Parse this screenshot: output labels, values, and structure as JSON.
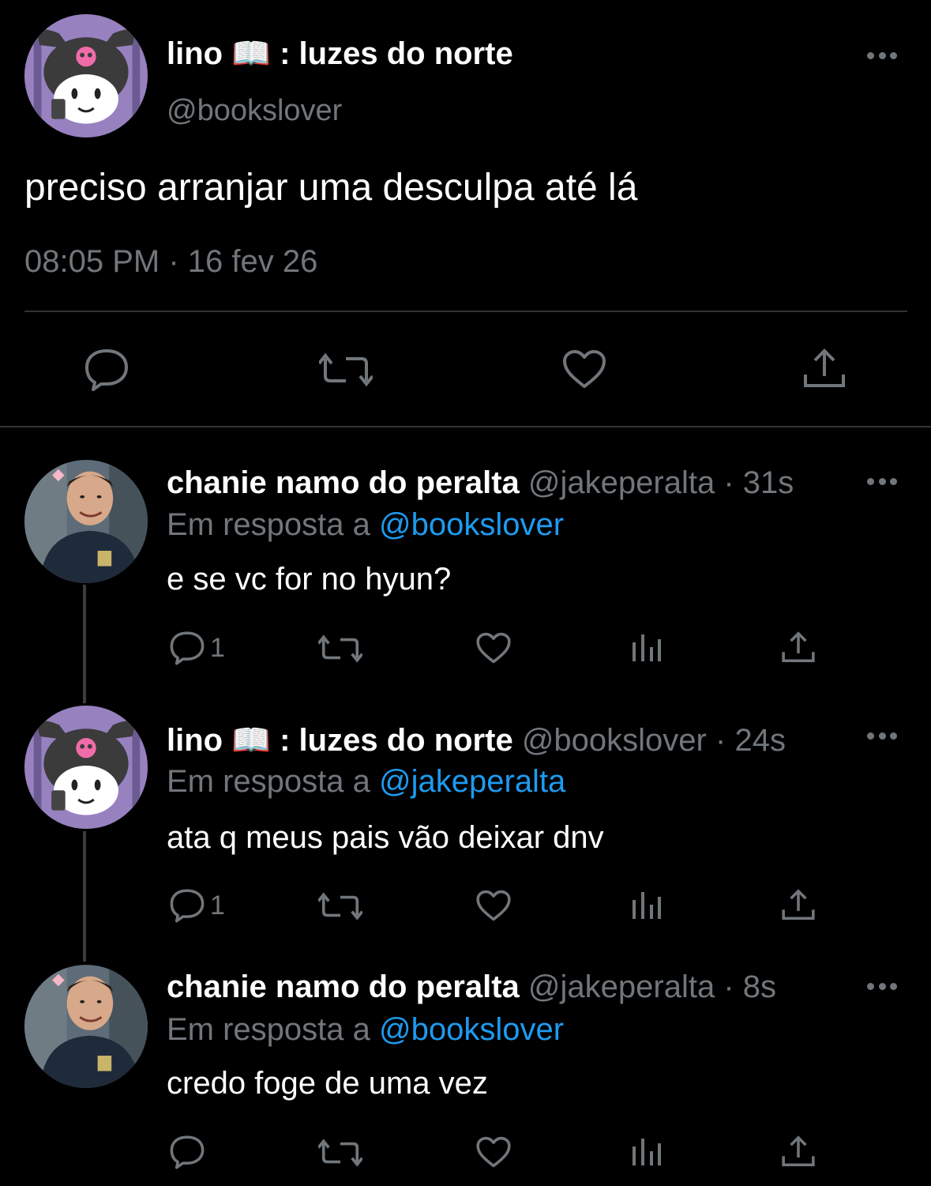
{
  "main_tweet": {
    "author_name": "lino 📖 : luzes do norte",
    "handle": "@bookslover",
    "text": "preciso arranjar uma desculpa até lá",
    "timestamp": "08:05 PM · 16 fev 26",
    "avatar": "kuromi-avatar"
  },
  "replies": [
    {
      "author_name": "chanie namo do peralta",
      "handle": "@jakeperalta",
      "separator": "·",
      "age": "31s",
      "replying_prefix": "Em resposta a",
      "replying_to": "@bookslover",
      "text": "e se vc for no hyun?",
      "reply_count": "1",
      "avatar": "jake-avatar"
    },
    {
      "author_name": "lino 📖 : luzes do norte",
      "handle": "@bookslover",
      "separator": "·",
      "age": "24s",
      "replying_prefix": "Em resposta a",
      "replying_to": "@jakeperalta",
      "text": "ata q meus pais vão deixar dnv",
      "reply_count": "1",
      "avatar": "kuromi-avatar"
    },
    {
      "author_name": "chanie namo do peralta",
      "handle": "@jakeperalta",
      "separator": "·",
      "age": "8s",
      "replying_prefix": "Em resposta a",
      "replying_to": "@bookslover",
      "text": "credo foge de uma vez",
      "reply_count": "",
      "avatar": "jake-avatar"
    }
  ],
  "icons": {
    "reply": "speech-bubble-icon",
    "retweet": "retweet-icon",
    "like": "heart-icon",
    "views": "bar-chart-icon",
    "share": "share-icon",
    "more": "ellipsis-icon"
  },
  "colors": {
    "background": "#000000",
    "text": "#ffffff",
    "secondary": "#71767b",
    "mention": "#1d9bf0",
    "divider": "#2f3336"
  }
}
